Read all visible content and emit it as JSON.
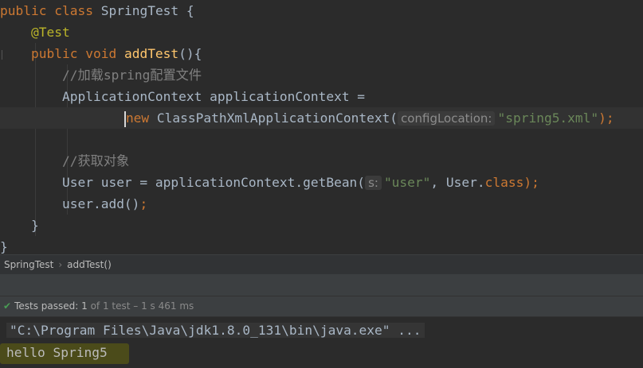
{
  "code": {
    "class_kw1": "public",
    "class_kw2": "class",
    "class_name": "SpringTest",
    "class_open": " {",
    "annotation": "@Test",
    "method_kw1": "public",
    "method_kw2": "void",
    "method_name": "addTest",
    "method_tail": "(){",
    "comment1": "//加载spring配置文件",
    "ctx_decl": "ApplicationContext applicationContext =",
    "new_kw": "new",
    "new_call": " ClassPathXmlApplicationContext(",
    "param_hint1": "configLocation:",
    "string1": "\"spring5.xml\"",
    "close1": ");",
    "comment2": "//获取对象",
    "getbean_prefix": "User user = applicationContext.getBean(",
    "param_hint2": "s:",
    "string2": "\"user\"",
    "getbean_mid": ", User.",
    "class_kw3": "class",
    "close2": ");",
    "add_call": "user.add()",
    "semi": ";",
    "brace_method": "}",
    "brace_class": "}"
  },
  "breadcrumb": {
    "class": "SpringTest",
    "method": "addTest()"
  },
  "status": {
    "label": "Tests passed:",
    "count": "1",
    "detail": "of 1 test – 1 s 461 ms"
  },
  "console": {
    "command": "\"C:\\Program Files\\Java\\jdk1.8.0_131\\bin\\java.exe\" ...",
    "output": "hello Spring5"
  },
  "colors": {
    "background": "#2b2b2b",
    "keyword": "#cc7832",
    "annotation": "#bbb529",
    "method": "#ffc66d",
    "string": "#6a8759",
    "comment": "#808080",
    "success": "#499c54"
  }
}
